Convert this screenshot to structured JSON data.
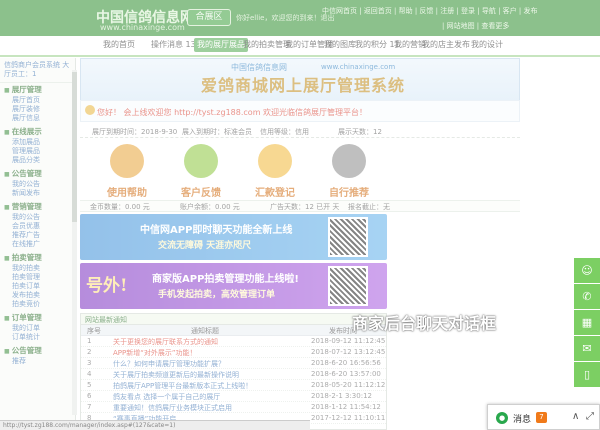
{
  "header": {
    "logo_cn": "中国信鸽信息网",
    "logo_en": "www.chinaxinge.com",
    "region_button": "合展区",
    "greeting": "你好ellie，欢迎您的到来！退出",
    "top_links": "中信网首页 | 返回首页 | 帮助 | 反馈 | 注册 | 登录 | 导航 | 客户 | 发布",
    "top_links_2": "| 网站地图 | 查看更多"
  },
  "nav": {
    "items": [
      {
        "label": "我的首页"
      },
      {
        "label": "操作消息 138"
      },
      {
        "label": "我的展厅展品"
      },
      {
        "label": "我的拍卖管理"
      },
      {
        "label": "我的订单管理"
      },
      {
        "label": "我的图库"
      },
      {
        "label": "我的积分 11"
      },
      {
        "label": "我的营销"
      },
      {
        "label": "我的店主发布"
      },
      {
        "label": "我的设计"
      }
    ]
  },
  "sidebar": {
    "head": "信鸽商户会员系统 大厅员工：1",
    "groups": [
      {
        "title": "展厅管理",
        "links": [
          "展厅首页",
          "展厅装修",
          "展厅信息"
        ]
      },
      {
        "title": "在线展示",
        "links": [
          "添加展品",
          "管理展品",
          "展品分类"
        ]
      },
      {
        "title": "公告管理",
        "links": [
          "我的公告",
          "新闻发布"
        ]
      },
      {
        "title": "营销管理",
        "links": [
          "我的公告",
          "会员优惠",
          "推荐广告",
          "在线推广"
        ]
      },
      {
        "title": "拍卖管理",
        "links": [
          "我的拍卖",
          "拍卖管理",
          "拍卖订单",
          "发布拍卖",
          "拍卖竞价"
        ]
      },
      {
        "title": "订单管理",
        "links": [
          "我的订单",
          "订单统计"
        ]
      },
      {
        "title": "公告管理",
        "links": [
          "推荐"
        ]
      }
    ]
  },
  "banner": {
    "brand_small": "中国信鸽信息网",
    "brand_en": "www.chinaxinge.com",
    "title": "爱鸽商城网上展厅管理系统",
    "subtitle": "www.chinaxinge.com",
    "welcome": "您好！ 会上线欢迎您 http://tyst.zg188.com 欢迎光临信鸽展厅管理平台！"
  },
  "stats": {
    "items": [
      {
        "text": "展厅到期时间：2018-9-30"
      },
      {
        "text": "展入到期时：标准会员"
      },
      {
        "text": "信用等级：信用"
      },
      {
        "text": "展示天数：12"
      }
    ]
  },
  "tiles": [
    {
      "label": "使用帮助",
      "color": "#e8a53a"
    },
    {
      "label": "客户反馈",
      "color": "#8cc63f"
    },
    {
      "label": "汇款登记",
      "color": "#f0b83a"
    },
    {
      "label": "自行推荐",
      "color": "#777777"
    }
  ],
  "infobar": {
    "items": [
      {
        "text": "金币数量：0.00 元"
      },
      {
        "text": "账户余额：0.00 元"
      },
      {
        "text": "广告天数：12 已开 天"
      },
      {
        "text": "报名截止：无"
      }
    ]
  },
  "ads": [
    {
      "logo": "",
      "text": "中信网APP即时聊天功能全新上线",
      "sub": "交流无障碍  天涯亦咫尺"
    },
    {
      "logo": "号外!",
      "text": "商家版APP拍卖管理功能上线啦!",
      "sub": "手机发起拍卖，高效管理订单"
    }
  ],
  "table": {
    "title": "网站最新通知",
    "headers": {
      "no": "序号",
      "title": "通知标题",
      "date": "发布时间"
    },
    "rows": [
      {
        "no": "1",
        "title": "关于更换您的展厅联系方式的通知",
        "date": "2018-09-12 11:12:45"
      },
      {
        "no": "2",
        "title": "APP新增“对外展示”功能！",
        "date": "2018-07-12 13:12:45"
      },
      {
        "no": "3",
        "title": "什么？如何申请展厅管理功能扩展？",
        "date": "2018-6-20 16:56:56"
      },
      {
        "no": "4",
        "title": "关于展厅拍卖频道更新后的最新操作说明",
        "date": "2018-6-20 13:57:00"
      },
      {
        "no": "5",
        "title": "拍鸽展厅APP管理平台最新版本正式上线啦！",
        "date": "2018-05-20 11:12:12"
      },
      {
        "no": "6",
        "title": "鸽友看点 选择一个属于自己的展厅",
        "date": "2018-2-1 3:30:12"
      },
      {
        "no": "7",
        "title": "重要通知！信鸽展厅业务模块正式启用",
        "date": "2018-1-12 11:54:12"
      },
      {
        "no": "8",
        "title": "“赛事直播”功能开启",
        "date": "2017-12-12 11:10:11"
      }
    ]
  },
  "float_buttons": [
    {
      "icon": "person-icon",
      "glyph": "☺"
    },
    {
      "icon": "phone-icon",
      "glyph": "✆"
    },
    {
      "icon": "qr-icon",
      "glyph": "▦"
    },
    {
      "icon": "wechat-icon",
      "glyph": "✉"
    },
    {
      "icon": "mobile-icon",
      "glyph": "▯"
    }
  ],
  "callout": "商家后台聊天对话框",
  "chat": {
    "label": "消息",
    "badge": "7",
    "up": "∧",
    "full": "⤢"
  },
  "status_text": "http://tyst.zg188.com/manager/index.asp#(127&cate=1)"
}
